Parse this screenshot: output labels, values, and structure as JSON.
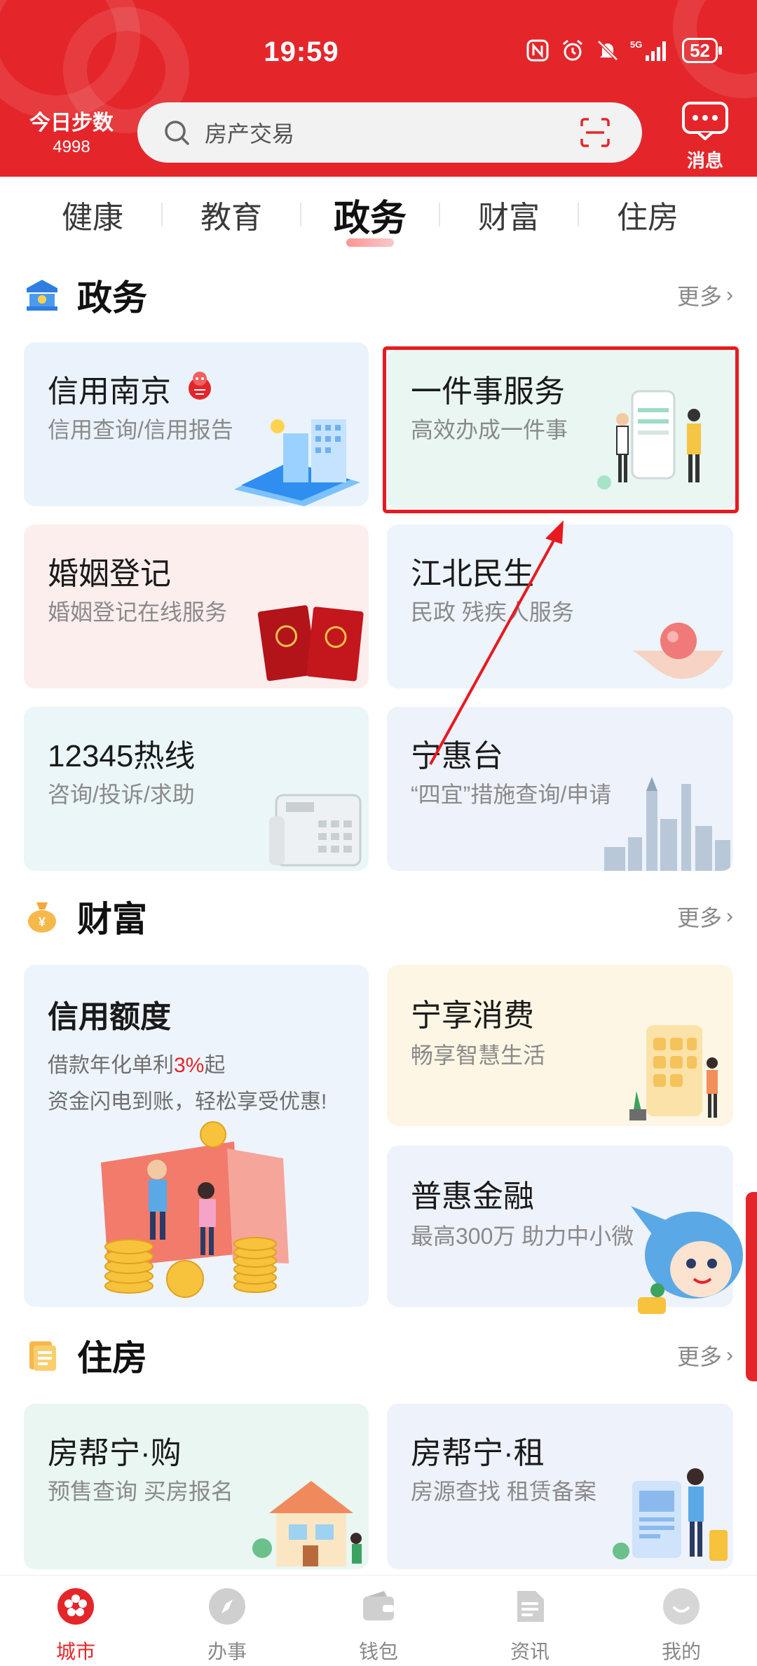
{
  "status_bar": {
    "time": "19:59",
    "battery": "52",
    "network": "5G"
  },
  "header": {
    "steps_label": "今日步数",
    "steps_value": "4998",
    "search_placeholder": "房产交易",
    "message_label": "消息",
    "brand_color": "#e4262b"
  },
  "tabs": [
    {
      "label": "健康",
      "active": false
    },
    {
      "label": "教育",
      "active": false
    },
    {
      "label": "政务",
      "active": true
    },
    {
      "label": "财富",
      "active": false
    },
    {
      "label": "住房",
      "active": false
    }
  ],
  "sections": {
    "gov": {
      "title": "政务",
      "more": "更多",
      "cards": [
        {
          "title": "信用南京",
          "subtitle": "信用查询/信用报告"
        },
        {
          "title": "一件事服务",
          "subtitle": "高效办成一件事"
        },
        {
          "title": "婚姻登记",
          "subtitle": "婚姻登记在线服务"
        },
        {
          "title": "江北民生",
          "subtitle": "民政 残疾人服务"
        },
        {
          "title": "12345热线",
          "subtitle": "咨询/投诉/求助"
        },
        {
          "title": "宁惠台",
          "subtitle": "“四宜”措施查询/申请"
        }
      ]
    },
    "wealth": {
      "title": "财富",
      "more": "更多",
      "credit": {
        "title": "信用额度",
        "line1_prefix": "借款年化单利",
        "line1_rate": "3%",
        "line1_suffix": "起",
        "line2": "资金闪电到账，轻松享受优惠!"
      },
      "cards": [
        {
          "title": "宁享消费",
          "subtitle": "畅享智慧生活"
        },
        {
          "title": "普惠金融",
          "subtitle": "最高300万 助力中小微"
        }
      ]
    },
    "housing": {
      "title": "住房",
      "more": "更多",
      "cards": [
        {
          "title": "房帮宁·购",
          "subtitle": "预售查询 买房报名"
        },
        {
          "title": "房帮宁·租",
          "subtitle": "房源查找 租赁备案"
        }
      ]
    }
  },
  "bottom_nav": [
    {
      "label": "城市",
      "icon": "city-flower-icon",
      "active": true
    },
    {
      "label": "办事",
      "icon": "compass-icon",
      "active": false
    },
    {
      "label": "钱包",
      "icon": "wallet-icon",
      "active": false
    },
    {
      "label": "资讯",
      "icon": "news-icon",
      "active": false
    },
    {
      "label": "我的",
      "icon": "profile-icon",
      "active": false
    }
  ]
}
